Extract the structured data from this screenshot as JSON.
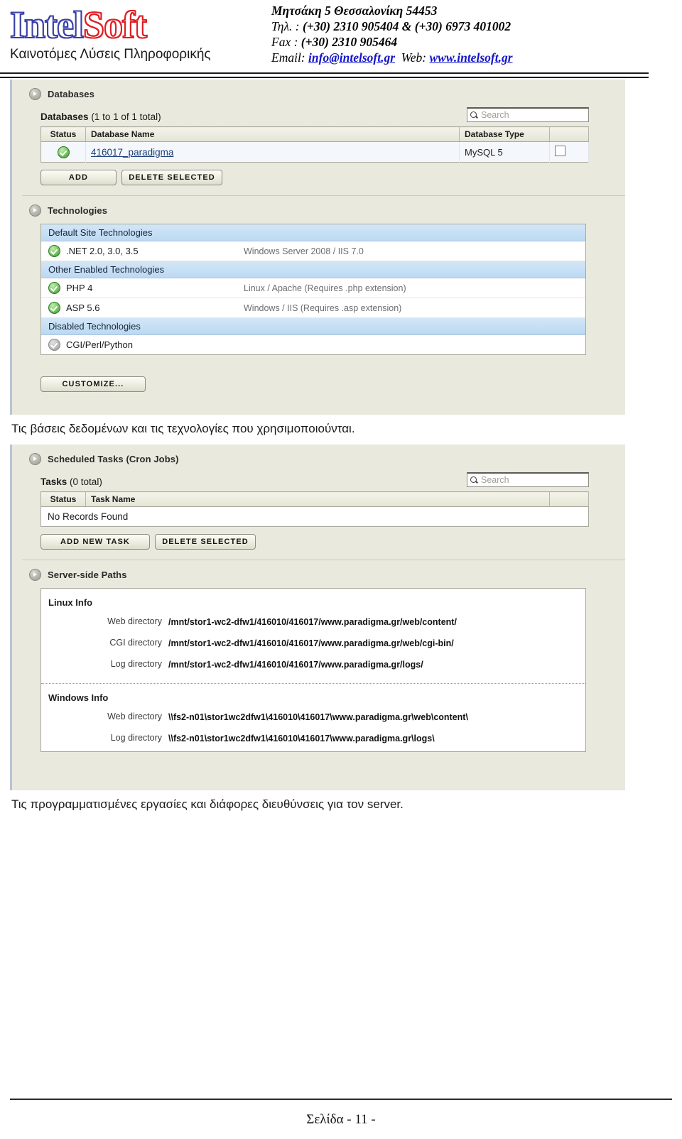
{
  "header": {
    "logo": {
      "part1": "Intel",
      "part2": "Soft",
      "tagline": "Καινοτόμες Λύσεις Πληροφορικής"
    },
    "contact": {
      "address": "Μητσάκη 5   Θεσσαλονίκη 54453",
      "phone_label": "Τηλ. :",
      "phone_value": "(+30) 2310 905404  &  (+30) 6973 401002",
      "fax_label": "Fax :",
      "fax_value": "(+30) 2310 905464",
      "email_label": "Email:",
      "email_value": "info@intelsoft.gr",
      "web_label": "Web:",
      "web_value": "www.intelsoft.gr"
    }
  },
  "screenshot1": {
    "databases_panel": {
      "title": "Databases",
      "list_label": "Databases",
      "list_count": "(1 to 1 of 1 total)",
      "search_placeholder": "Search",
      "columns": [
        "Status",
        "Database Name",
        "Database Type",
        ""
      ],
      "rows": [
        {
          "status": "ok",
          "name": "416017_paradigma",
          "type": "MySQL 5",
          "selected": false
        }
      ],
      "buttons": [
        "ADD",
        "DELETE SELECTED"
      ]
    },
    "technologies_panel": {
      "title": "Technologies",
      "groups": [
        {
          "label": "Default Site Technologies",
          "items": [
            {
              "status": "ok",
              "name": ".NET 2.0, 3.0, 3.5",
              "desc": "Windows Server 2008 / IIS 7.0"
            }
          ]
        },
        {
          "label": "Other Enabled Technologies",
          "items": [
            {
              "status": "ok",
              "name": "PHP 4",
              "desc": "Linux / Apache (Requires .php extension)"
            },
            {
              "status": "ok",
              "name": "ASP 5.6",
              "desc": "Windows / IIS (Requires .asp extension)"
            }
          ]
        },
        {
          "label": "Disabled Technologies",
          "items": [
            {
              "status": "off",
              "name": "CGI/Perl/Python",
              "desc": ""
            }
          ]
        }
      ],
      "button": "CUSTOMIZE..."
    }
  },
  "caption1": "Τις βάσεις δεδομένων και τις τεχνολογίες που χρησιμοποιούνται.",
  "screenshot2": {
    "tasks_panel": {
      "title": "Scheduled Tasks (Cron Jobs)",
      "list_label": "Tasks",
      "list_count": "(0 total)",
      "search_placeholder": "Search",
      "columns": [
        "Status",
        "Task Name",
        ""
      ],
      "empty_message": "No Records Found",
      "buttons": [
        "ADD NEW TASK",
        "DELETE SELECTED"
      ]
    },
    "paths_panel": {
      "title": "Server-side Paths",
      "linux": {
        "heading": "Linux Info",
        "rows": [
          {
            "label": "Web directory",
            "value": "/mnt/stor1-wc2-dfw1/416010/416017/www.paradigma.gr/web/content/"
          },
          {
            "label": "CGI directory",
            "value": "/mnt/stor1-wc2-dfw1/416010/416017/www.paradigma.gr/web/cgi-bin/"
          },
          {
            "label": "Log directory",
            "value": "/mnt/stor1-wc2-dfw1/416010/416017/www.paradigma.gr/logs/"
          }
        ]
      },
      "windows": {
        "heading": "Windows Info",
        "rows": [
          {
            "label": "Web directory",
            "value": "\\\\fs2-n01\\stor1wc2dfw1\\416010\\416017\\www.paradigma.gr\\web\\content\\"
          },
          {
            "label": "Log directory",
            "value": "\\\\fs2-n01\\stor1wc2dfw1\\416010\\416017\\www.paradigma.gr\\logs\\"
          }
        ]
      }
    }
  },
  "caption2": "Τις προγραμματισμένες εργασίες και διάφορες διευθύνσεις για τον server.",
  "footer": {
    "page_label": "Σελίδα  - 11 -"
  }
}
